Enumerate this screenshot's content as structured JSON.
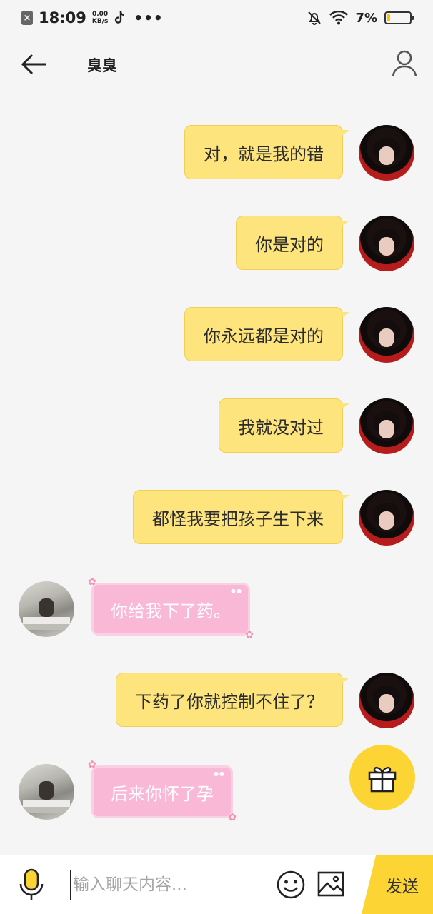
{
  "status_bar": {
    "time": "18:09",
    "speed_value": "0.00",
    "speed_unit": "KB/s",
    "more": "•••",
    "battery_percent": "7%",
    "battery_level": 0.07,
    "battery_color": "#f3c400"
  },
  "header": {
    "title": "臭臭",
    "back_icon": "arrow-left-icon",
    "profile_icon": "person-icon"
  },
  "messages": [
    {
      "sender": "me",
      "text": "对，就是我的错"
    },
    {
      "sender": "me",
      "text": "你是对的"
    },
    {
      "sender": "me",
      "text": "你永远都是对的"
    },
    {
      "sender": "me",
      "text": "我就没对过"
    },
    {
      "sender": "me",
      "text": "都怪我要把孩子生下来"
    },
    {
      "sender": "other",
      "text": "你给我下了药。"
    },
    {
      "sender": "me",
      "text": "下药了你就控制不住了？"
    },
    {
      "sender": "other",
      "text": "后来你怀了孕"
    }
  ],
  "input_bar": {
    "placeholder": "输入聊天内容...",
    "send_label": "发送",
    "accent": "#fcd535"
  },
  "gift_icon": "gift-icon"
}
